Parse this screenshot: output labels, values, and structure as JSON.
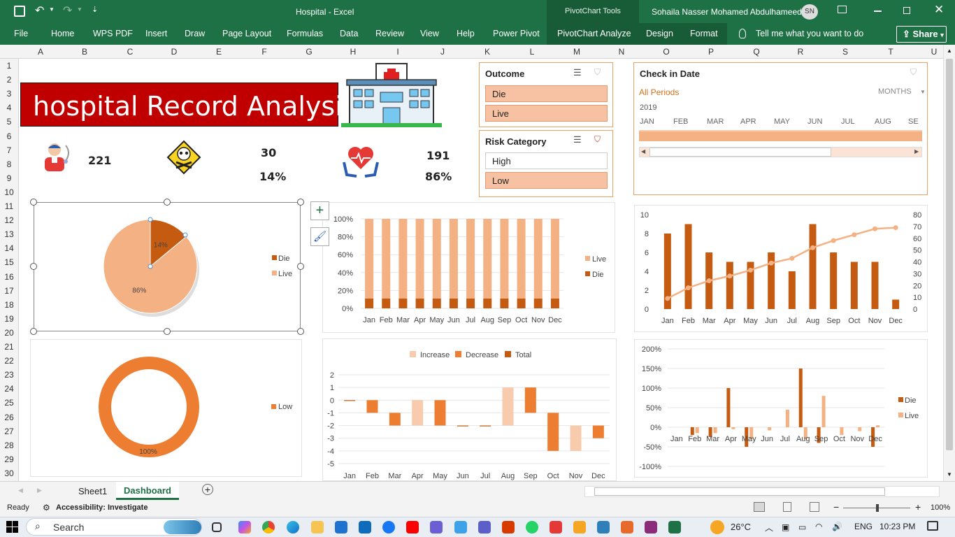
{
  "window": {
    "title": "Hospital  -  Excel",
    "contextual_tab": "PivotChart Tools",
    "user": "Sohaila Nasser Mohamed Abdulhameed",
    "user_initials": "SN",
    "share": "Share"
  },
  "ribbon": {
    "tabs": [
      "File",
      "Home",
      "WPS PDF",
      "Insert",
      "Draw",
      "Page Layout",
      "Formulas",
      "Data",
      "Review",
      "View",
      "Help",
      "Power Pivot",
      "PivotChart Analyze",
      "Design",
      "Format"
    ],
    "tell_me": "Tell me what you want to do"
  },
  "columns": [
    "A",
    "B",
    "C",
    "D",
    "E",
    "F",
    "G",
    "H",
    "I",
    "J",
    "K",
    "L",
    "M",
    "N",
    "O",
    "P",
    "Q",
    "R",
    "S",
    "T",
    "U"
  ],
  "rows": [
    "1",
    "2",
    "3",
    "4",
    "5",
    "6",
    "7",
    "8",
    "9",
    "10",
    "11",
    "12",
    "13",
    "14",
    "15",
    "16",
    "17",
    "18",
    "19",
    "20",
    "21",
    "22",
    "23",
    "24",
    "25",
    "26",
    "27",
    "28",
    "29",
    "30"
  ],
  "dashboard": {
    "title": "hospital Record Analysis",
    "kpis": {
      "total": "221",
      "died": "30",
      "died_pct": "14%",
      "lived": "191",
      "lived_pct": "86%"
    }
  },
  "slicers": {
    "outcome": {
      "title": "Outcome",
      "items": [
        "Die",
        "Live"
      ]
    },
    "risk": {
      "title": "Risk Category",
      "items": [
        "High",
        "Low"
      ]
    },
    "date": {
      "title": "Check in Date",
      "period": "All Periods",
      "level": "MONTHS",
      "year": "2019",
      "months": [
        "JAN",
        "FEB",
        "MAR",
        "APR",
        "MAY",
        "JUN",
        "JUL",
        "AUG",
        "SE"
      ]
    }
  },
  "sheets": {
    "tabs": [
      "Sheet1",
      "Dashboard"
    ],
    "active": "Dashboard"
  },
  "status": {
    "ready": "Ready",
    "accessibility": "Accessibility: Investigate",
    "zoom": "100%"
  },
  "taskbar": {
    "search": "Search",
    "weather": "26°C",
    "language": "ENG",
    "time": "10:23 PM"
  },
  "colors": {
    "dark": "#c55a11",
    "mid": "#ed7d31",
    "light": "#f4b183",
    "pale": "#f8cbad",
    "banner": "#c00000"
  },
  "chart_data": [
    {
      "id": "outcome_pie",
      "type": "pie",
      "categories": [
        "Die",
        "Live"
      ],
      "values": [
        14,
        86
      ],
      "labels": [
        "14%",
        "86%"
      ],
      "legend": [
        "Die",
        "Live"
      ]
    },
    {
      "id": "risk_donut",
      "type": "pie",
      "categories": [
        "Low"
      ],
      "values": [
        100
      ],
      "labels": [
        "100%"
      ],
      "legend": [
        "Low"
      ]
    },
    {
      "id": "stacked_pct",
      "type": "bar",
      "categories": [
        "Jan",
        "Feb",
        "Mar",
        "Apr",
        "May",
        "Jun",
        "Jul",
        "Aug",
        "Sep",
        "Oct",
        "Nov",
        "Dec"
      ],
      "series": [
        {
          "name": "Live",
          "values": [
            89,
            89,
            89,
            89,
            89,
            89,
            89,
            89,
            89,
            89,
            89,
            89
          ]
        },
        {
          "name": "Die",
          "values": [
            11,
            11,
            11,
            11,
            11,
            11,
            11,
            11,
            11,
            11,
            11,
            11
          ]
        }
      ],
      "yticks": [
        "0%",
        "20%",
        "40%",
        "60%",
        "80%",
        "100%"
      ],
      "ylim": [
        0,
        100
      ]
    },
    {
      "id": "combo",
      "type": "bar",
      "categories": [
        "Jan",
        "Feb",
        "Mar",
        "Apr",
        "May",
        "Jun",
        "Jul",
        "Aug",
        "Sep",
        "Oct",
        "Nov",
        "Dec"
      ],
      "bars": [
        8,
        9,
        6,
        5,
        5,
        6,
        4,
        9,
        6,
        5,
        5,
        1
      ],
      "line": [
        9,
        18,
        24,
        28,
        33,
        39,
        43,
        52,
        58,
        63,
        68,
        69
      ],
      "ylim": [
        0,
        10
      ],
      "y2lim": [
        0,
        80
      ],
      "yticks": [
        "0",
        "2",
        "4",
        "6",
        "8",
        "10"
      ],
      "y2ticks": [
        "0",
        "10",
        "20",
        "30",
        "40",
        "50",
        "60",
        "70",
        "80"
      ]
    },
    {
      "id": "waterfall",
      "type": "bar",
      "categories": [
        "Jan",
        "Feb",
        "Mar",
        "Apr",
        "May",
        "Jun",
        "Jul",
        "Aug",
        "Sep",
        "Oct",
        "Nov",
        "Dec"
      ],
      "segments": [
        [
          0,
          0,
          "Total"
        ],
        [
          0,
          -1,
          "Decrease"
        ],
        [
          -1,
          -2,
          "Decrease"
        ],
        [
          -2,
          0,
          "Increase"
        ],
        [
          0,
          -2,
          "Decrease"
        ],
        [
          -2,
          -2,
          "Total"
        ],
        [
          -2,
          -2,
          "Total"
        ],
        [
          -2,
          1,
          "Increase"
        ],
        [
          1,
          -1,
          "Decrease"
        ],
        [
          -1,
          -4,
          "Decrease"
        ],
        [
          -4,
          -2,
          "Increase"
        ],
        [
          -2,
          -3,
          "Decrease"
        ]
      ],
      "legend": [
        "Increase",
        "Decrease",
        "Total"
      ],
      "ylim": [
        -5,
        2
      ],
      "yticks": [
        "2",
        "1",
        "0",
        "-1",
        "-2",
        "-3",
        "-4",
        "-5"
      ]
    },
    {
      "id": "pct_change",
      "type": "bar",
      "categories": [
        "Jan",
        "Feb",
        "Mar",
        "Apr",
        "May",
        "Jun",
        "Jul",
        "Aug",
        "Sep",
        "Oct",
        "Nov",
        "Dec"
      ],
      "series": [
        {
          "name": "Die",
          "values": [
            0,
            -20,
            -25,
            100,
            -50,
            0,
            0,
            150,
            -40,
            0,
            0,
            -50
          ]
        },
        {
          "name": "Live",
          "values": [
            0,
            -15,
            -15,
            -5,
            -30,
            -8,
            45,
            -30,
            80,
            -20,
            -10,
            5
          ]
        }
      ],
      "ylim": [
        -100,
        200
      ],
      "yticks": [
        "200%",
        "150%",
        "100%",
        "50%",
        "0%",
        "-50%",
        "-100%"
      ]
    }
  ]
}
